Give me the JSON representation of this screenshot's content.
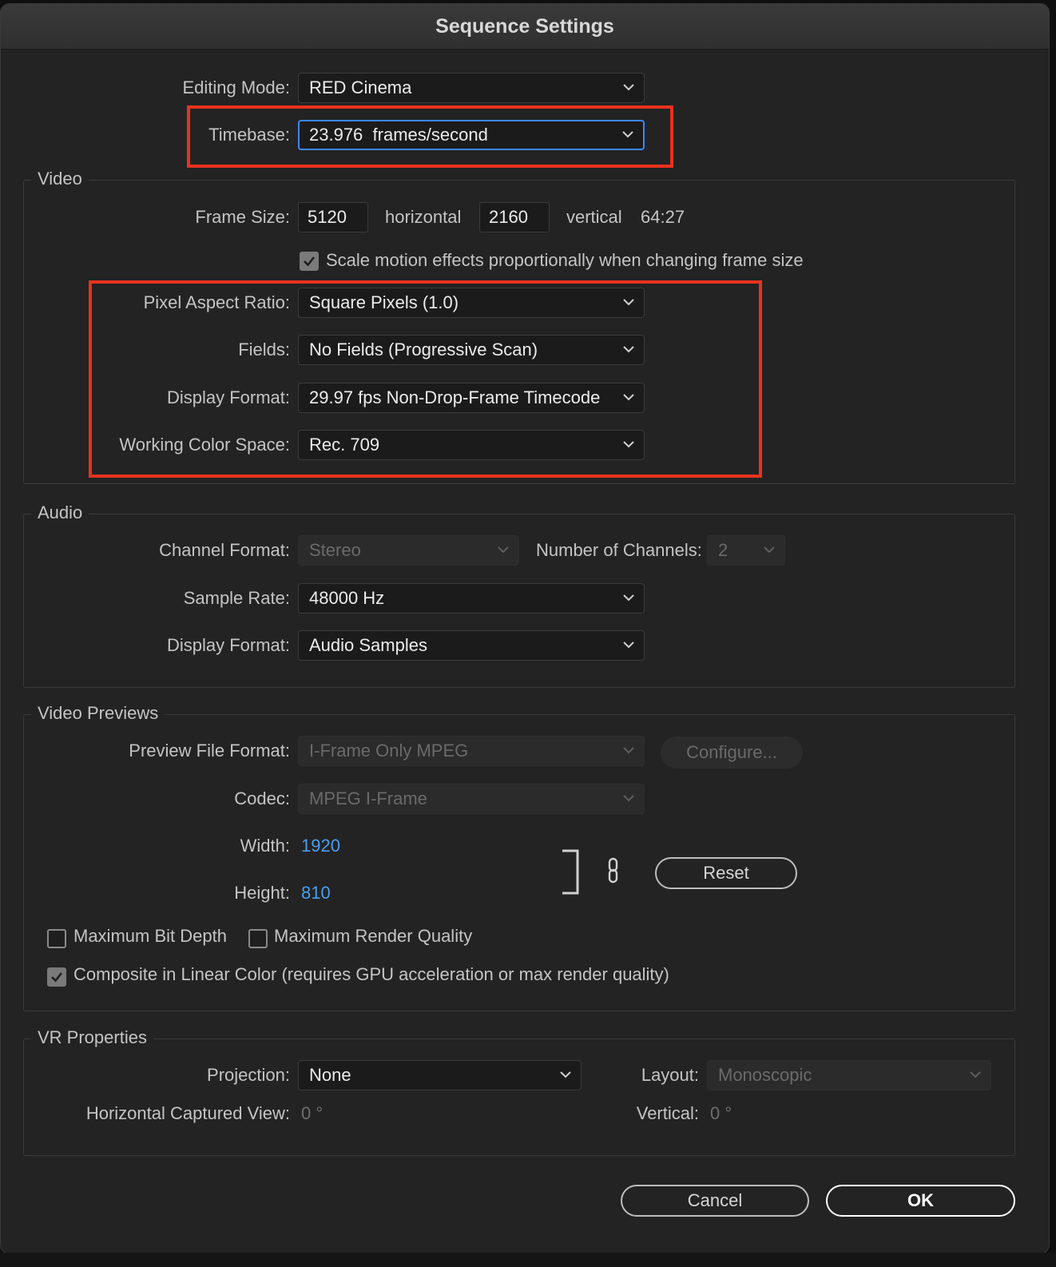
{
  "window": {
    "title": "Sequence Settings"
  },
  "colors": {
    "highlight": "#e8321e",
    "focus": "#3c86ff",
    "link_value": "#4a9df0"
  },
  "general": {
    "editing_mode_label": "Editing Mode:",
    "editing_mode_value": "RED Cinema",
    "timebase_label": "Timebase:",
    "timebase_value": "23.976  frames/second"
  },
  "video": {
    "title": "Video",
    "frame_size_label": "Frame Size:",
    "frame_width": "5120",
    "horizontal_label": "horizontal",
    "frame_height": "2160",
    "vertical_label": "vertical",
    "aspect": "64:27",
    "scale_motion_label": "Scale motion effects proportionally when changing frame size",
    "scale_motion_checked": true,
    "par_label": "Pixel Aspect Ratio:",
    "par_value": "Square Pixels (1.0)",
    "fields_label": "Fields:",
    "fields_value": "No Fields (Progressive Scan)",
    "display_format_label": "Display Format:",
    "display_format_value": "29.97 fps Non-Drop-Frame Timecode",
    "color_space_label": "Working Color Space:",
    "color_space_value": "Rec. 709"
  },
  "audio": {
    "title": "Audio",
    "channel_format_label": "Channel Format:",
    "channel_format_value": "Stereo",
    "num_channels_label": "Number of Channels:",
    "num_channels_value": "2",
    "sample_rate_label": "Sample Rate:",
    "sample_rate_value": "48000 Hz",
    "display_format_label": "Display Format:",
    "display_format_value": "Audio Samples"
  },
  "previews": {
    "title": "Video Previews",
    "file_format_label": "Preview File Format:",
    "file_format_value": "I-Frame Only MPEG",
    "configure_label": "Configure...",
    "codec_label": "Codec:",
    "codec_value": "MPEG I-Frame",
    "width_label": "Width:",
    "width_value": "1920",
    "height_label": "Height:",
    "height_value": "810",
    "reset_label": "Reset",
    "max_bit_depth_label": "Maximum Bit Depth",
    "max_bit_depth_checked": false,
    "max_render_quality_label": "Maximum Render Quality",
    "max_render_quality_checked": false,
    "linear_color_label": "Composite in Linear Color (requires GPU acceleration or max render quality)",
    "linear_color_checked": true
  },
  "vr": {
    "title": "VR Properties",
    "projection_label": "Projection:",
    "projection_value": "None",
    "layout_label": "Layout:",
    "layout_value": "Monoscopic",
    "h_view_label": "Horizontal Captured View:",
    "h_view_value": "0 °",
    "vertical_label": "Vertical:",
    "vertical_value": "0 °"
  },
  "buttons": {
    "cancel": "Cancel",
    "ok": "OK"
  }
}
